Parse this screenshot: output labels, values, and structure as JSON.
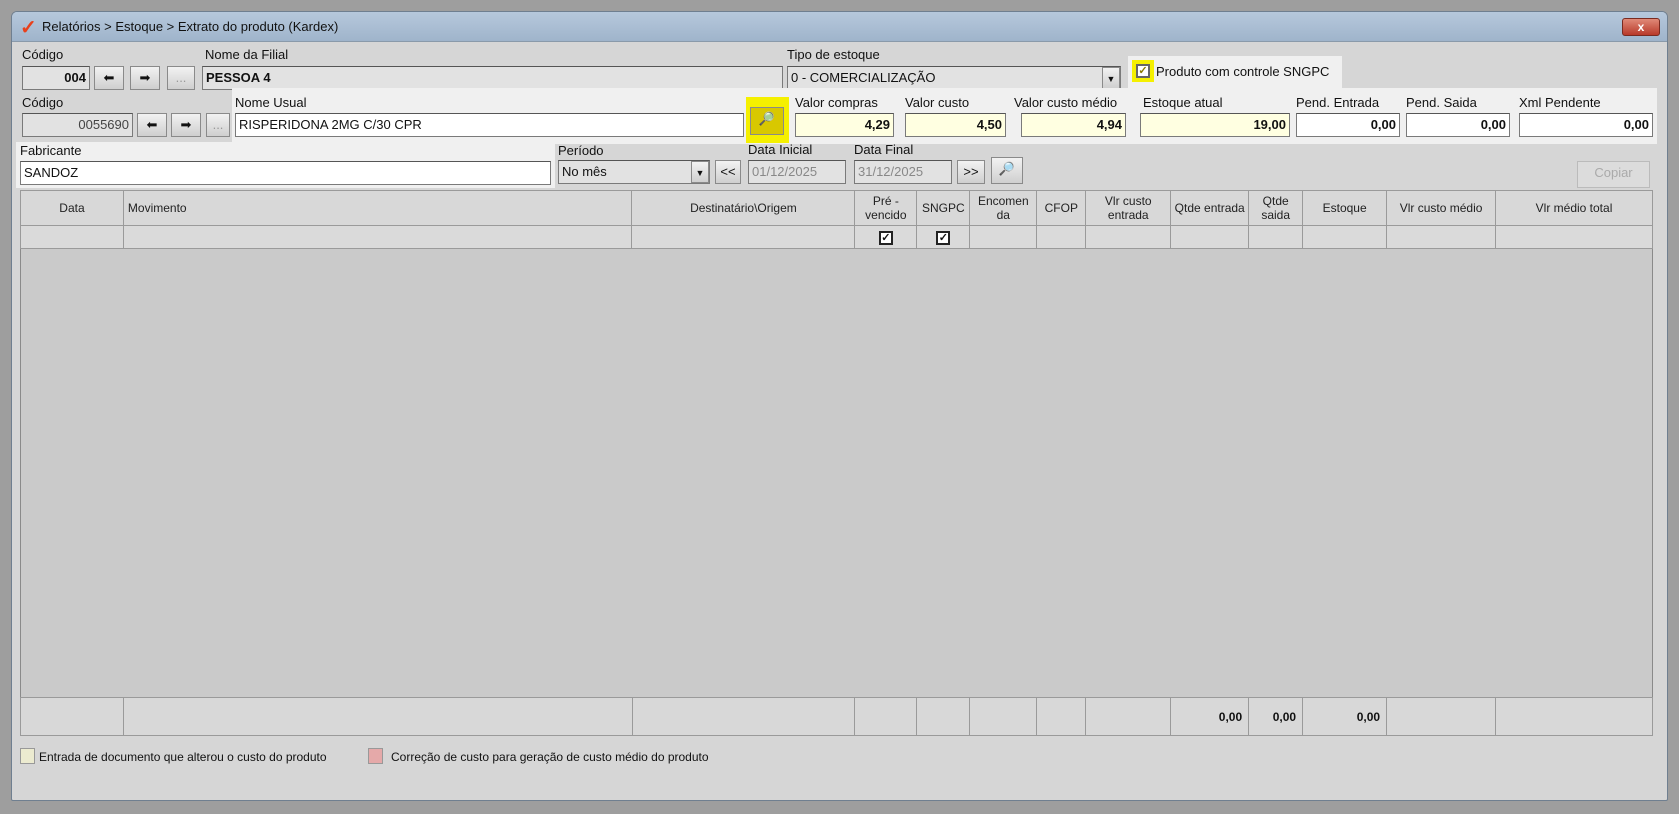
{
  "window": {
    "title": "Relatórios > Estoque > Extrato do produto (Kardex)",
    "close_label": "x"
  },
  "filial": {
    "codigo_label": "Código",
    "codigo": "004",
    "nome_label": "Nome da Filial",
    "nome": "PESSOA 4",
    "dots": "..."
  },
  "tipo_estoque": {
    "label": "Tipo de estoque",
    "value": "0 - COMERCIALIZAÇÃO"
  },
  "sngpc": {
    "label": "Produto com controle SNGPC",
    "checked": true
  },
  "produto": {
    "codigo_label": "Código",
    "codigo": "0055690",
    "dots": "...",
    "nome_label": "Nome Usual",
    "nome": "RISPERIDONA 2MG C/30 CPR"
  },
  "valores": [
    {
      "label": "Valor compras",
      "value": "4,29"
    },
    {
      "label": "Valor custo",
      "value": "4,50"
    },
    {
      "label": "Valor custo médio",
      "value": "4,94"
    },
    {
      "label": "Estoque atual",
      "value": "19,00"
    },
    {
      "label": "Pend. Entrada",
      "value": "0,00"
    },
    {
      "label": "Pend. Saida",
      "value": "0,00"
    },
    {
      "label": "Xml Pendente",
      "value": "0,00"
    }
  ],
  "fabricante": {
    "label": "Fabricante",
    "value": "SANDOZ"
  },
  "periodo": {
    "label": "Período",
    "value": "No mês",
    "prev": "<<",
    "next": ">>",
    "data_inicial_label": "Data Inicial",
    "data_inicial": "01/12/2025",
    "data_final_label": "Data Final",
    "data_final": "31/12/2025"
  },
  "copiar_label": "Copiar",
  "table": {
    "columns": [
      "Data",
      "Movimento",
      "Destinatário\\Origem",
      "Pré - vencido",
      "SNGPC",
      "Encomen da",
      "CFOP",
      "Vlr custo entrada",
      "Qtde entrada",
      "Qtde saida",
      "Estoque",
      "Vlr custo médio",
      "Vlr médio total"
    ],
    "totals": {
      "qtde_entrada": "0,00",
      "qtde_saida": "0,00",
      "estoque": "0,00"
    }
  },
  "legend": [
    {
      "label": "Entrada de documento que alterou o custo do produto",
      "color": "#ecebd0"
    },
    {
      "label": "Correção de custo para geração de custo médio do produto",
      "color": "#e5a9a9"
    }
  ]
}
